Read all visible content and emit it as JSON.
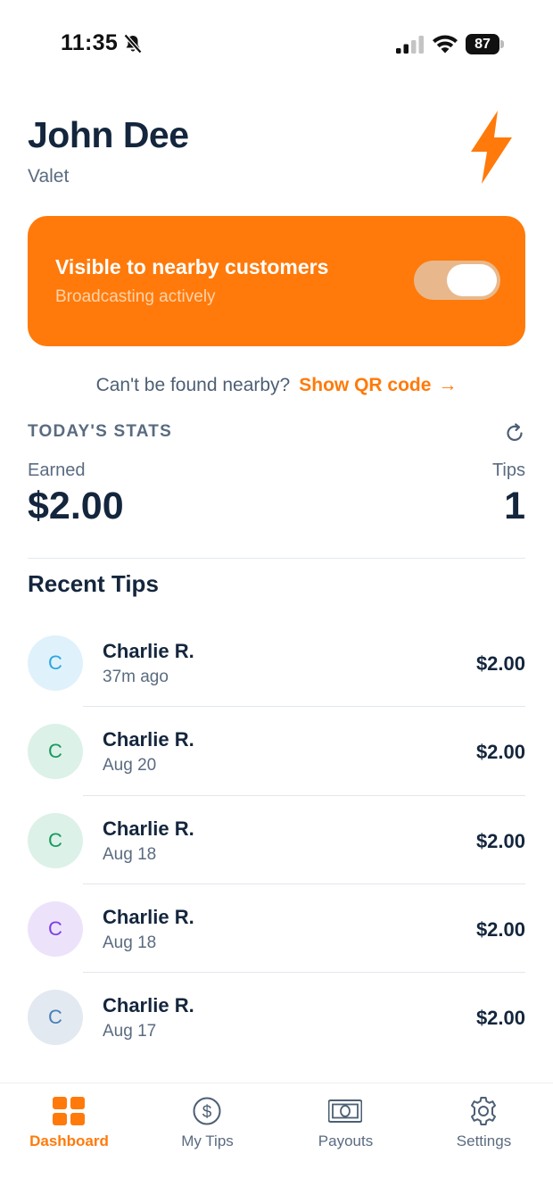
{
  "status_bar": {
    "time": "11:35",
    "battery": "87"
  },
  "header": {
    "name": "John Dee",
    "role": "Valet"
  },
  "visibility": {
    "title": "Visible to nearby customers",
    "subtitle": "Broadcasting actively",
    "toggle_on": true
  },
  "qr": {
    "question": "Can't be found nearby?",
    "link": "Show QR code",
    "arrow": "→"
  },
  "stats": {
    "heading": "TODAY'S STATS",
    "earned_label": "Earned",
    "earned_value": "$2.00",
    "tips_label": "Tips",
    "tips_value": "1"
  },
  "recent": {
    "heading": "Recent Tips",
    "items": [
      {
        "initial": "C",
        "name": "Charlie R.",
        "time": "37m ago",
        "amount": "$2.00"
      },
      {
        "initial": "C",
        "name": "Charlie R.",
        "time": "Aug 20",
        "amount": "$2.00"
      },
      {
        "initial": "C",
        "name": "Charlie R.",
        "time": "Aug 18",
        "amount": "$2.00"
      },
      {
        "initial": "C",
        "name": "Charlie R.",
        "time": "Aug 18",
        "amount": "$2.00"
      },
      {
        "initial": "C",
        "name": "Charlie R.",
        "time": "Aug 17",
        "amount": "$2.00"
      }
    ]
  },
  "tabs": [
    {
      "label": "Dashboard",
      "icon": "dashboard-grid-icon",
      "active": true
    },
    {
      "label": "My Tips",
      "icon": "dollar-circle-icon",
      "active": false
    },
    {
      "label": "Payouts",
      "icon": "banknote-icon",
      "active": false
    },
    {
      "label": "Settings",
      "icon": "gear-icon",
      "active": false
    }
  ],
  "colors": {
    "accent": "#ff7a0a",
    "text_dark": "#14263d",
    "text_muted": "#5a6b80",
    "avatar_blue_bg": "#dff1fb",
    "avatar_blue_fg": "#2aa8e0",
    "avatar_green_bg": "#dcf1e8",
    "avatar_green_fg": "#18995f",
    "avatar_purple_bg": "#ece3fb",
    "avatar_purple_fg": "#7b3fe4",
    "avatar_slate_bg": "#e3e9f1",
    "avatar_slate_fg": "#4a7fb8"
  }
}
